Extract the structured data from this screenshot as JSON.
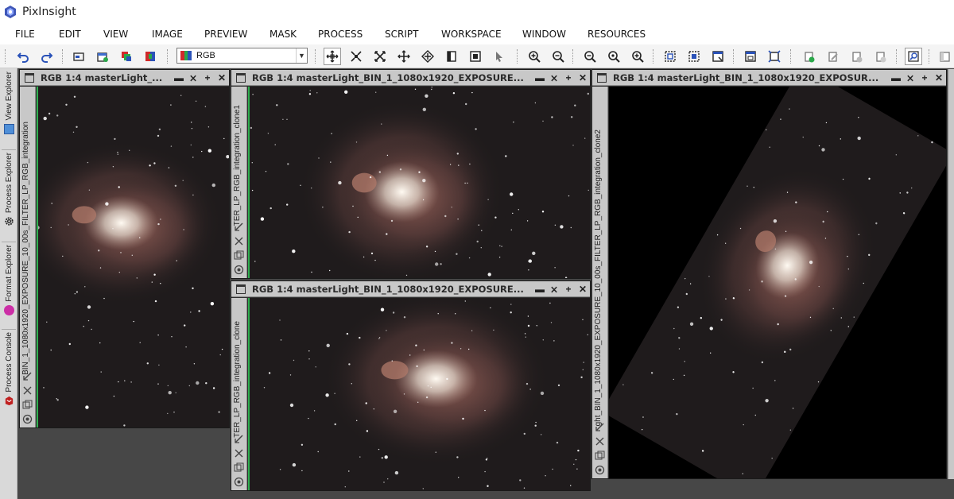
{
  "app": {
    "title": "PixInsight",
    "logo_icon": "pixinsight-logo-icon"
  },
  "menu": [
    {
      "label": "FILE"
    },
    {
      "label": "EDIT"
    },
    {
      "label": "VIEW"
    },
    {
      "label": "IMAGE"
    },
    {
      "label": "PREVIEW"
    },
    {
      "label": "MASK"
    },
    {
      "label": "PROCESS"
    },
    {
      "label": "SCRIPT"
    },
    {
      "label": "WORKSPACE"
    },
    {
      "label": "WINDOW"
    },
    {
      "label": "RESOURCES"
    }
  ],
  "toolbar": {
    "channel_select": {
      "value": "RGB",
      "icon": "rgb-channels-icon"
    },
    "icons": [
      "undo-icon",
      "redo-icon",
      "image-info-icon",
      "new-image-icon",
      "clone-image-icon",
      "swap-image-icon",
      "pan-mode-icon",
      "zoom-fit-icon",
      "zoom-in-mode-icon",
      "zoom-out-mode-icon",
      "readout-mode-icon",
      "mask-icon",
      "preview-icon",
      "pointer-icon",
      "zoom-in-icon",
      "zoom-out-icon",
      "zoom-1-1-icon",
      "zoom-fit-window-icon",
      "zoom-full-icon",
      "select-preview-icon",
      "edit-preview-icon",
      "new-window-icon",
      "fit-view-icon",
      "zoom-previews-icon",
      "new-process-icon",
      "edit-process-icon",
      "delete-process-icon",
      "reset-process-icon",
      "active-tool-icon",
      "more-icon"
    ]
  },
  "left_dock": {
    "tabs": [
      {
        "label": "View Explorer",
        "icon": "view-explorer-icon",
        "color": "#4f8fd8"
      },
      {
        "label": "Process Explorer",
        "icon": "gear-icon",
        "color": "#333333"
      },
      {
        "label": "Format Explorer",
        "icon": "format-explorer-icon",
        "color": "#cc2ea6"
      },
      {
        "label": "Process Console",
        "icon": "process-console-icon",
        "color": "#c02020"
      }
    ]
  },
  "windows": [
    {
      "title": "RGB 1:4 masterLight_...",
      "side_label": "BIN_1_1080x1920_EXPOSURE_10_00s_FILTER_LP_RGB_integration",
      "variant": "portrait"
    },
    {
      "title": "RGB 1:4 masterLight_BIN_1_1080x1920_EXPOSURE...",
      "side_label": "TER_LP_RGB_integration_clone1",
      "variant": "landscape_a"
    },
    {
      "title": "RGB 1:4 masterLight_BIN_1_1080x1920_EXPOSURE...",
      "side_label": "TER_LP_RGB_integration_clone",
      "variant": "landscape_b"
    },
    {
      "title": "RGB 1:4 masterLight_BIN_1_1080x1920_EXPOSUR...",
      "side_label": "ght_BIN_1_1080x1920_EXPOSURE_10_00s_FILTER_LP_RGB_integration_clone2",
      "variant": "rotated"
    }
  ],
  "window_controls": [
    "shade-icon",
    "collapse-icon",
    "maximize-icon",
    "close-icon"
  ],
  "colors": {
    "nebula_core": "#fffaf2",
    "nebula_dust": "#8a5a52",
    "sky": "#1f1b1c",
    "active_border": "#2fae4f"
  }
}
